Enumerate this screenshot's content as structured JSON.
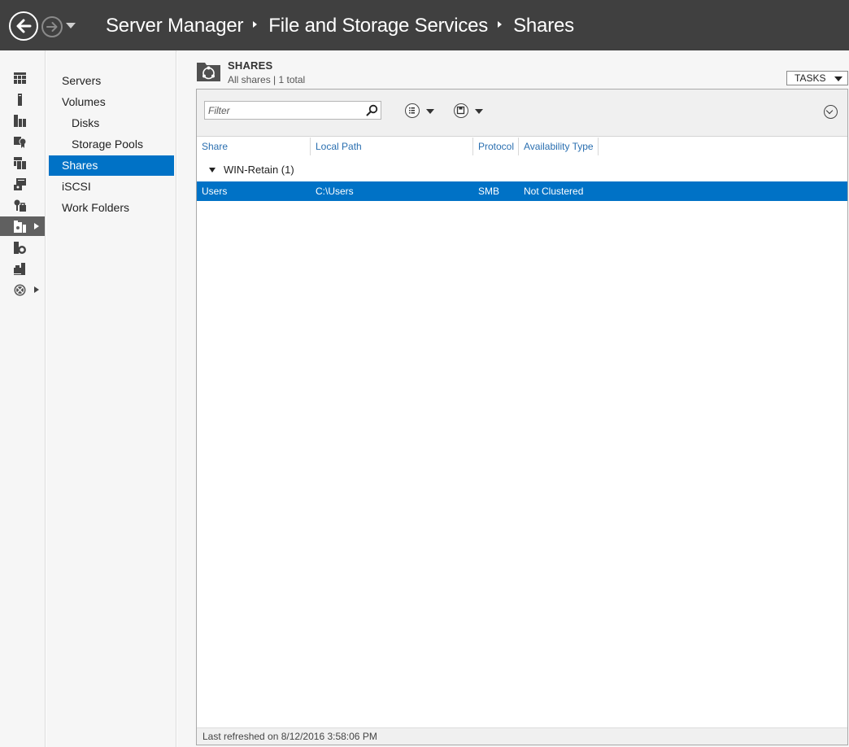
{
  "window": {
    "breadcrumb": [
      "Server Manager",
      "File and Storage Services",
      "Shares"
    ]
  },
  "rail": {
    "items": [
      {
        "icon": "dashboard-icon"
      },
      {
        "icon": "local-server-icon"
      },
      {
        "icon": "all-servers-icon"
      },
      {
        "icon": "ad-certificate-services-icon"
      },
      {
        "icon": "ad-domain-services-icon"
      },
      {
        "icon": "dhcp-icon"
      },
      {
        "icon": "dns-icon"
      },
      {
        "icon": "file-storage-services-icon"
      },
      {
        "icon": "iis-icon"
      },
      {
        "icon": "print-services-icon"
      },
      {
        "icon": "remote-access-icon"
      }
    ]
  },
  "subnav": {
    "items": [
      {
        "label": "Servers"
      },
      {
        "label": "Volumes"
      },
      {
        "label": "Disks"
      },
      {
        "label": "Storage Pools"
      },
      {
        "label": "Shares"
      },
      {
        "label": "iSCSI"
      },
      {
        "label": "Work Folders"
      }
    ]
  },
  "tile": {
    "title": "SHARES",
    "subtitle": "All shares | 1 total",
    "tasks_label": "TASKS"
  },
  "toolbar": {
    "filter_placeholder": "Filter",
    "filter_value": ""
  },
  "table": {
    "columns": [
      "Share",
      "Local Path",
      "Protocol",
      "Availability Type"
    ],
    "groups": [
      {
        "label": "WIN-Retain (1)",
        "rows": [
          {
            "share": "Users",
            "path": "C:\\Users",
            "protocol": "SMB",
            "availability": "Not Clustered"
          }
        ]
      }
    ]
  },
  "status": {
    "last_refreshed": "Last refreshed on 8/12/2016 3:58:06 PM"
  },
  "colors": {
    "titlebar": "#404040",
    "accent": "#0072c6",
    "rail_active": "#606060",
    "header_link": "#2a6fb0"
  }
}
